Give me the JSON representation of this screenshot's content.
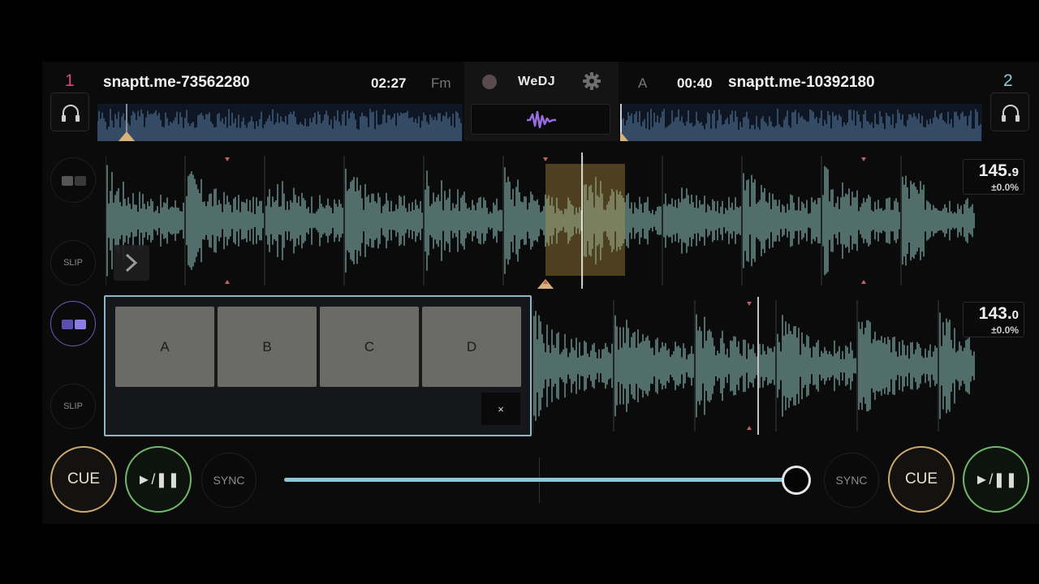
{
  "deck1": {
    "number": "1",
    "title": "snaptt.me-73562280",
    "time": "02:27",
    "key": "Fm",
    "bpm_int": "145.",
    "bpm_dec": "9",
    "pitch": "±0.0%",
    "slip_label": "SLIP",
    "cue_label": "CUE",
    "play_label": "►/❚❚",
    "sync_label": "SYNC"
  },
  "deck2": {
    "number": "2",
    "title": "snaptt.me-10392180",
    "time": "00:40",
    "key": "A",
    "bpm_int": "143.",
    "bpm_dec": "0",
    "pitch": "±0.0%",
    "slip_label": "SLIP",
    "cue_label": "CUE",
    "play_label": "►/❚❚",
    "sync_label": "SYNC"
  },
  "center": {
    "logo": "WeDJ"
  },
  "hotcue": {
    "pads": [
      "A",
      "B",
      "C",
      "D"
    ],
    "close_label": "×"
  },
  "crossfader": {
    "position": 1.0
  },
  "colors": {
    "deck1_accent": "#d04f7a",
    "deck2_accent": "#8ec9d6",
    "waveform": "#a6e6e0",
    "cue_ring": "#c9aa6a",
    "play_ring": "#72b86a",
    "selected_loop": "#c8a048"
  }
}
